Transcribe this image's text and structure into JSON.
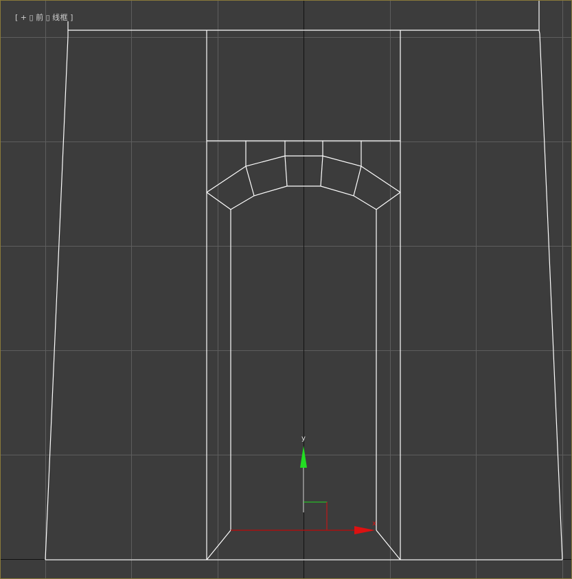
{
  "viewport": {
    "label": {
      "bracket_open": "[",
      "plus": "+",
      "sep1": "▯",
      "view": "前",
      "sep2": "▯",
      "shading": "线框",
      "bracket_close": "]"
    },
    "gizmo": {
      "y_label": "y",
      "x_label": "x"
    },
    "colors": {
      "background": "#3c3c3c",
      "grid": "#5e5e5e",
      "home_grid": "#111111",
      "wire": "#ffffff",
      "axis_y": "#22dd22",
      "axis_x": "#dd1111",
      "border": "#8a7a3a"
    }
  }
}
